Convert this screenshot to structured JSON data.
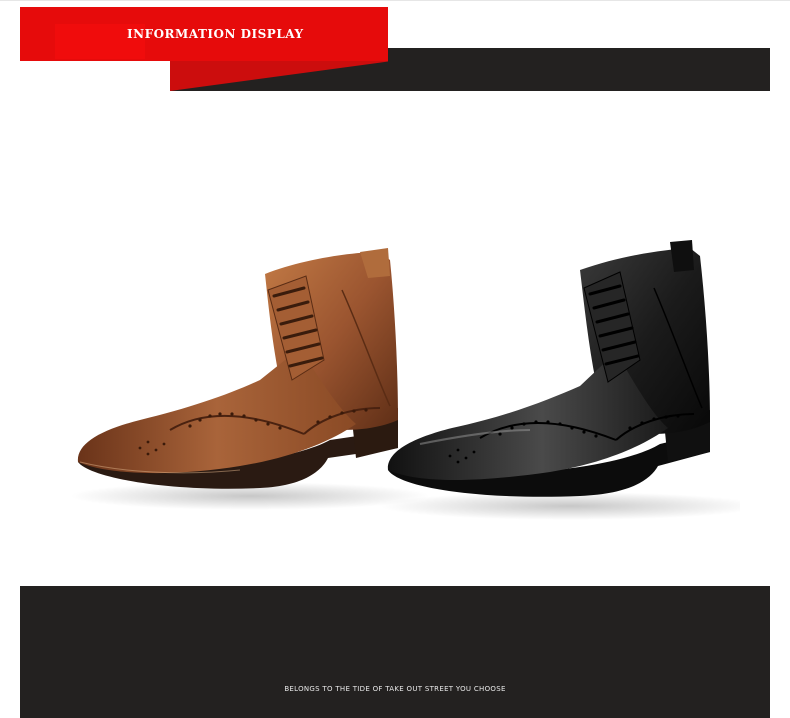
{
  "header": {
    "title": "INFORMATION DISPLAY"
  },
  "product": {
    "image_alt": "brown and black wingtip brogue lace-up ankle boots",
    "colors": {
      "brown_boot": "#8e4a26",
      "black_boot": "#151515",
      "accent_red": "#e60b0b",
      "dark_band": "#232120"
    }
  },
  "footer": {
    "tagline": "BELONGS TO THE TIDE OF TAKE OUT STREET YOU CHOOSE"
  }
}
